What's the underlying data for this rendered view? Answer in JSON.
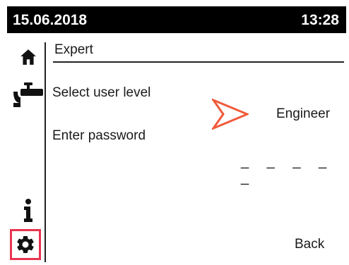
{
  "status_bar": {
    "date": "15.06.2018",
    "time": "13:28"
  },
  "sidebar": {
    "items": [
      {
        "icon": "home-icon"
      },
      {
        "icon": "tap-icon"
      },
      {
        "icon": "info-icon"
      },
      {
        "icon": "gear-icon",
        "selected": true
      }
    ],
    "selection_color": "#e8344f"
  },
  "screen": {
    "title": "Expert",
    "user_level_label": "Select user level",
    "user_level_value": "Engineer",
    "password_label": "Enter password",
    "password_value": "_ _ _ _ _",
    "arrow_color": "#f05a3a"
  },
  "footer": {
    "back_label": "Back"
  }
}
